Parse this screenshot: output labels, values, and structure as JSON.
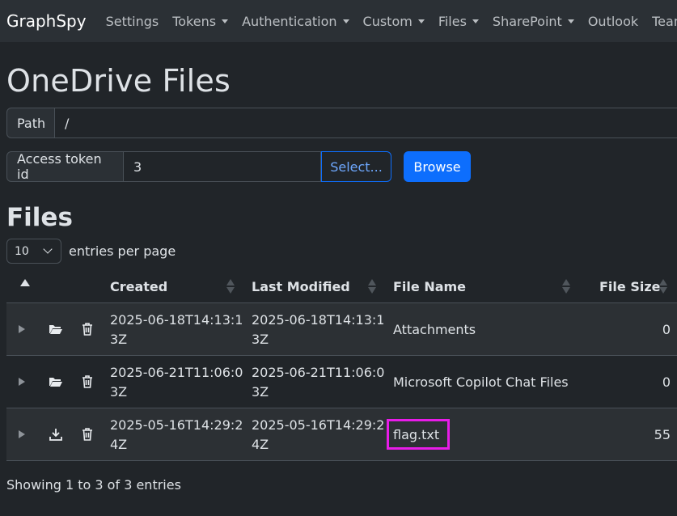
{
  "navbar": {
    "brand": "GraphSpy",
    "items": [
      {
        "label": "Settings",
        "dropdown": false
      },
      {
        "label": "Tokens",
        "dropdown": true
      },
      {
        "label": "Authentication",
        "dropdown": true
      },
      {
        "label": "Custom",
        "dropdown": true
      },
      {
        "label": "Files",
        "dropdown": true
      },
      {
        "label": "SharePoint",
        "dropdown": true
      },
      {
        "label": "Outlook",
        "dropdown": false
      },
      {
        "label": "Teams",
        "dropdown": false
      }
    ]
  },
  "page_title": "OneDrive Files",
  "path": {
    "label": "Path",
    "value": "/"
  },
  "token": {
    "label": "Access token id",
    "value": "3",
    "select_label": "Select...",
    "browse_label": "Browse"
  },
  "files_title": "Files",
  "per_page": {
    "value": "10",
    "label": "entries per page"
  },
  "table": {
    "headers": {
      "created": "Created",
      "last_modified": "Last Modified",
      "file_name": "File Name",
      "file_size": "File Size"
    },
    "rows": [
      {
        "created_1": "2025-06-18T14:13:1",
        "created_2": "3Z",
        "modified_1": "2025-06-18T14:13:1",
        "modified_2": "3Z",
        "name": "Attachments",
        "size": "0",
        "type": "folder-open-icon"
      },
      {
        "created_1": "2025-06-21T11:06:0",
        "created_2": "3Z",
        "modified_1": "2025-06-21T11:06:0",
        "modified_2": "3Z",
        "name": "Microsoft Copilot Chat Files",
        "size": "0",
        "type": "folder-open-icon"
      },
      {
        "created_1": "2025-05-16T14:29:2",
        "created_2": "4Z",
        "modified_1": "2025-05-16T14:29:2",
        "modified_2": "4Z",
        "name": "flag.txt",
        "size": "55",
        "type": "download-icon"
      }
    ]
  },
  "footer": {
    "showing": "Showing 1 to 3 of 3 entries"
  },
  "colors": {
    "highlight": "#e81ce8",
    "primary": "#0d6efd",
    "background": "#212529"
  }
}
